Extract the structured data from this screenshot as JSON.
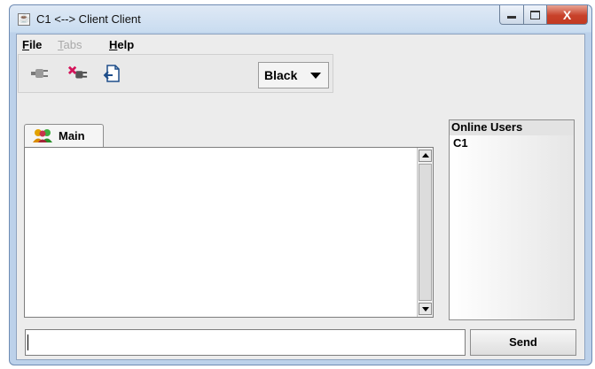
{
  "window": {
    "title": "C1 <--> Client Client",
    "close_glyph": "X"
  },
  "menu": {
    "file": {
      "mnemonic": "F",
      "rest": "ile"
    },
    "tabs": {
      "mnemonic": "T",
      "rest": "abs"
    },
    "help": {
      "mnemonic": "H",
      "rest": "elp"
    }
  },
  "toolbar": {
    "icons": [
      "plug-connect-icon",
      "plug-disconnect-icon",
      "export-log-icon"
    ],
    "color_select": {
      "value": "Black"
    }
  },
  "tabs": [
    {
      "label": "Main",
      "icon": "users-icon",
      "selected": true
    }
  ],
  "users": {
    "title": "Online Users",
    "items": [
      "C1"
    ]
  },
  "input": {
    "value": ""
  },
  "send": {
    "label": "Send"
  },
  "colors": {
    "titlebar": "#c9dcf0",
    "close_button": "#c8412a",
    "background": "#ececec"
  }
}
